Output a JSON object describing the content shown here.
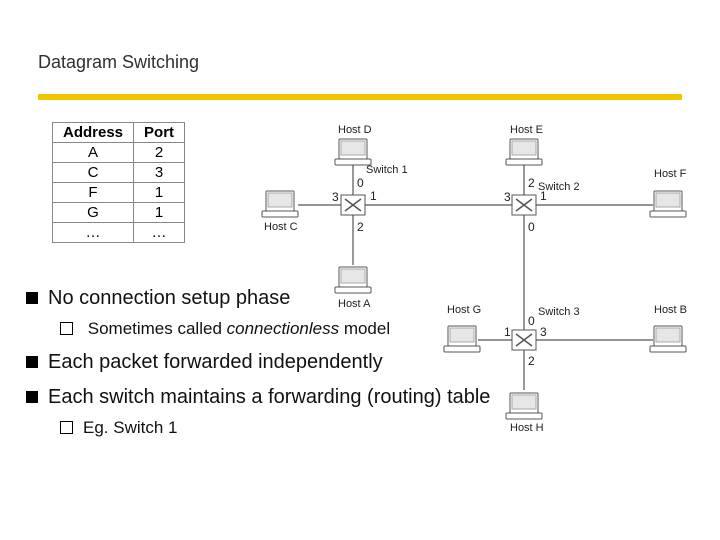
{
  "title": "Datagram Switching",
  "table": {
    "headers": [
      "Address",
      "Port"
    ],
    "rows": [
      [
        "A",
        "2"
      ],
      [
        "C",
        "3"
      ],
      [
        "F",
        "1"
      ],
      [
        "G",
        "1"
      ],
      [
        "…",
        "…"
      ]
    ]
  },
  "bullets": {
    "b1": "No connection setup phase",
    "b1a": "Sometimes called ",
    "b1a_italic": "connectionless",
    "b1a_tail": " model",
    "b2": "Each packet forwarded independently",
    "b3": "Each switch  maintains a forwarding (routing) table",
    "b3a": "Eg. Switch 1"
  },
  "diagram": {
    "hosts": {
      "A": "Host A",
      "B": "Host B",
      "C": "Host C",
      "D": "Host D",
      "E": "Host E",
      "F": "Host F",
      "G": "Host G",
      "H": "Host H"
    },
    "switches": {
      "s1": "Switch 1",
      "s2": "Switch 2",
      "s3": "Switch 3"
    },
    "ports": [
      "0",
      "1",
      "2",
      "3"
    ]
  }
}
